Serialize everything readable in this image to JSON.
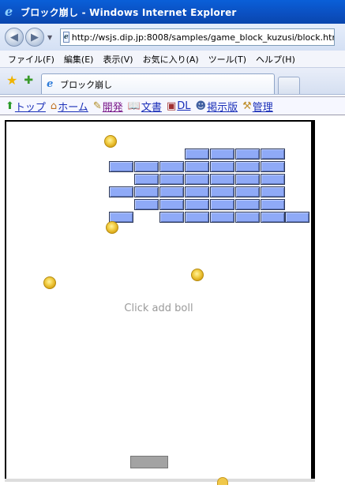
{
  "window": {
    "title": "ブロック崩し - Windows Internet Explorer"
  },
  "address_bar": {
    "url": "http://wsjs.dip.jp:8008/samples/game_block_kuzusi/block.html"
  },
  "menu": {
    "items": [
      "ファイル(F)",
      "編集(E)",
      "表示(V)",
      "お気に入り(A)",
      "ツール(T)",
      "ヘルプ(H)"
    ]
  },
  "tabs": [
    {
      "label": "ブロック崩し"
    }
  ],
  "site_nav": {
    "links": [
      {
        "label": "トップ",
        "icon": "up-arrow-icon"
      },
      {
        "label": "ホーム",
        "icon": "home-icon"
      },
      {
        "label": "開発",
        "icon": "edit-icon"
      },
      {
        "label": "文書",
        "icon": "book-icon"
      },
      {
        "label": "DL",
        "icon": "download-icon"
      },
      {
        "label": "掲示版",
        "icon": "users-icon"
      },
      {
        "label": "管理",
        "icon": "tool-icon"
      }
    ]
  },
  "game": {
    "hint": "Click add boll",
    "brick_color": "#8faaf7",
    "ball_color": "#e8b82a",
    "paddle_color": "#a3a3a3"
  }
}
